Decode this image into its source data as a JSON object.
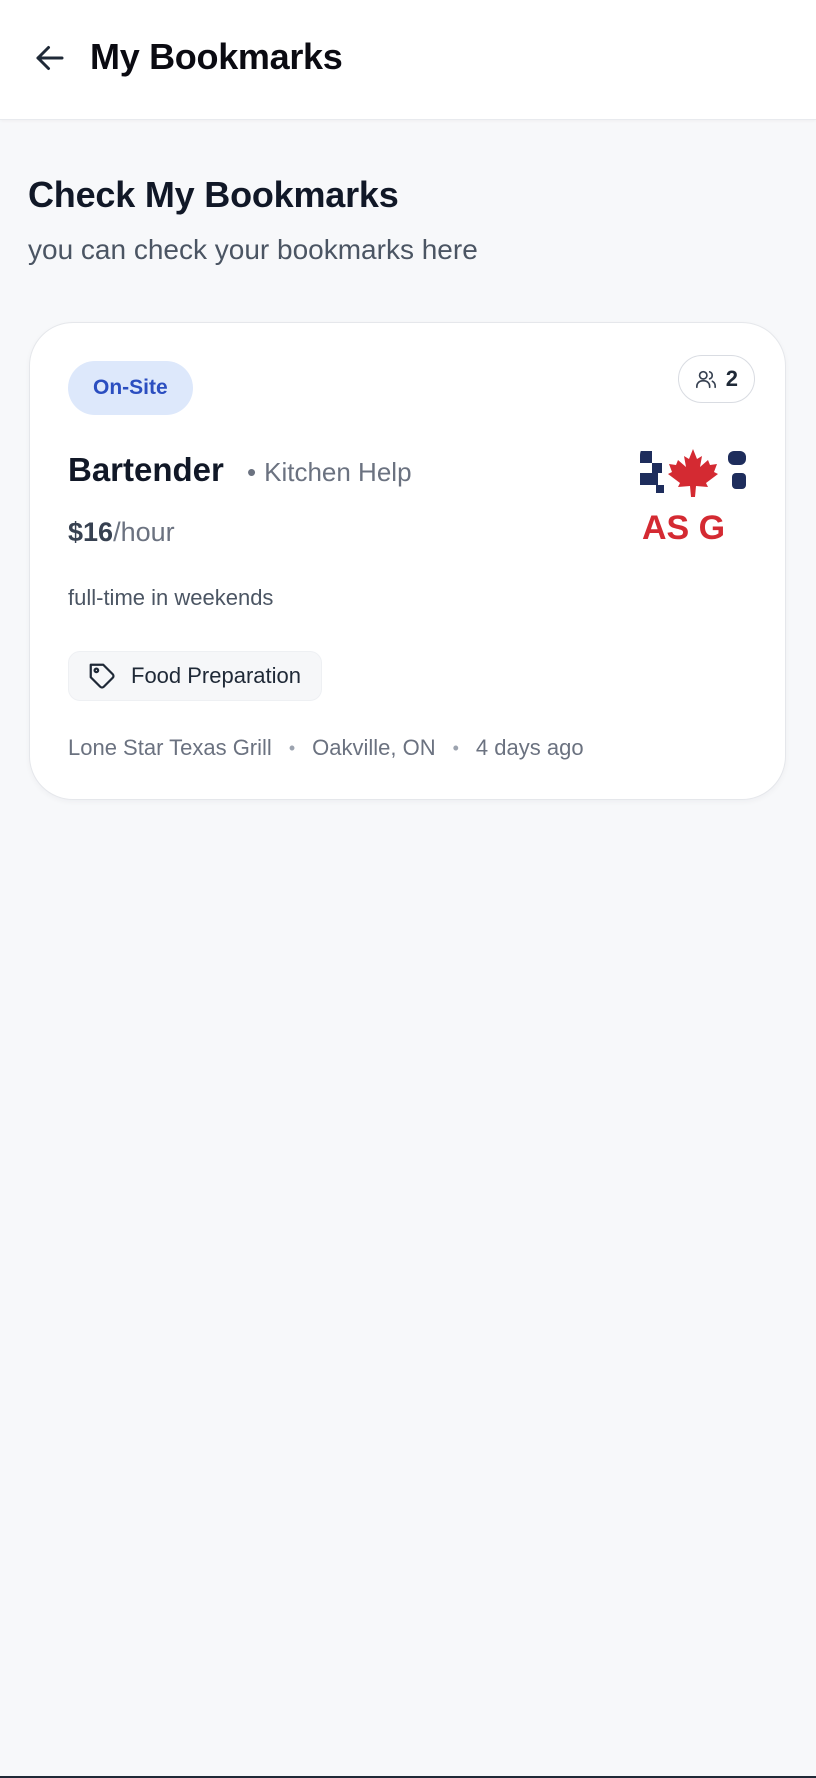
{
  "header": {
    "title": "My Bookmarks",
    "back_icon": "arrow-left-icon"
  },
  "intro": {
    "title": "Check My Bookmarks",
    "subtitle": "you can check your bookmarks here"
  },
  "bookmarks": [
    {
      "work_type": "On-Site",
      "applicants_count": "2",
      "applicants_icon": "users-icon",
      "title": "Bartender",
      "category_separator": "•",
      "category": "Kitchen Help",
      "pay_amount": "$16",
      "pay_unit": "/hour",
      "schedule": "full-time in weekends",
      "skill_icon": "tag-icon",
      "skill": "Food Preparation",
      "company": "Lone Star Texas Grill",
      "location": "Oakville, ON",
      "posted": "4 days ago",
      "meta_separator": "•",
      "logo_text": "AS G",
      "logo_icon": "maple-leaf-icon"
    }
  ],
  "colors": {
    "badge_bg": "#dde8fb",
    "badge_text": "#2b4ec0",
    "logo_navy": "#1e2d5c",
    "logo_red": "#d42a32"
  }
}
